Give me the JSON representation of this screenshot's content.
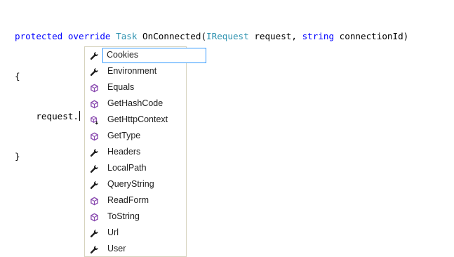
{
  "code": {
    "line1": {
      "kw1": "protected",
      "kw2": "override",
      "type1": "Task",
      "method": "OnConnected",
      "paren_open": "(",
      "type2": "IRequest",
      "param1": "request",
      "comma": ",",
      "kw3": "string",
      "param2": "connectionId",
      "paren_close": ")"
    },
    "line2": "{",
    "line3": "    request.",
    "line4": "}"
  },
  "intellisense": {
    "items": [
      {
        "label": "Cookies",
        "icon": "wrench-icon",
        "selected": true
      },
      {
        "label": "Environment",
        "icon": "wrench-icon"
      },
      {
        "label": "Equals",
        "icon": "method-icon"
      },
      {
        "label": "GetHashCode",
        "icon": "method-icon"
      },
      {
        "label": "GetHttpContext",
        "icon": "extension-method-icon"
      },
      {
        "label": "GetType",
        "icon": "method-icon"
      },
      {
        "label": "Headers",
        "icon": "wrench-icon"
      },
      {
        "label": "LocalPath",
        "icon": "wrench-icon"
      },
      {
        "label": "QueryString",
        "icon": "wrench-icon"
      },
      {
        "label": "ReadForm",
        "icon": "method-icon"
      },
      {
        "label": "ToString",
        "icon": "method-icon"
      },
      {
        "label": "Url",
        "icon": "wrench-icon"
      },
      {
        "label": "User",
        "icon": "wrench-icon"
      }
    ]
  },
  "colors": {
    "keyword": "#0000ff",
    "type": "#2b91af",
    "method_icon": "#8a4bb0",
    "selection_border": "#3399ff"
  }
}
